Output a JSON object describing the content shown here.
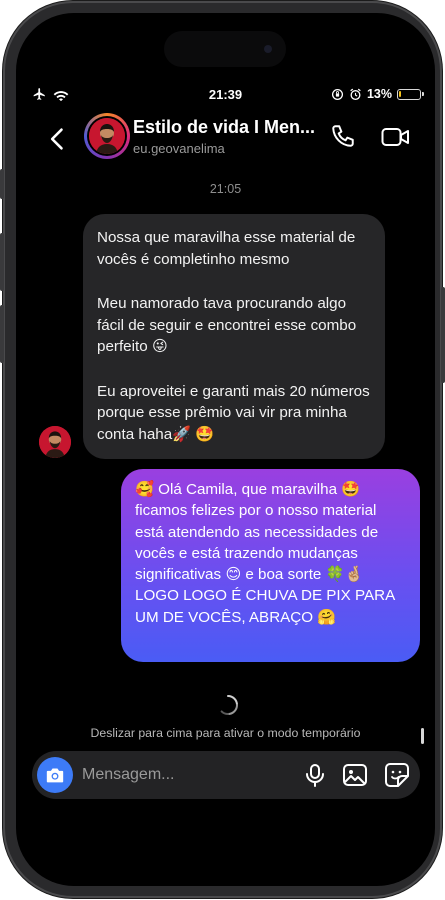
{
  "status_bar": {
    "time": "21:39",
    "battery_percent": "13%",
    "battery_level": 0.13
  },
  "header": {
    "title": "Estilo de vida I Men...",
    "username": "eu.geovanelima"
  },
  "conversation": {
    "timestamp": "21:05",
    "incoming": {
      "paragraphs": [
        "Nossa que maravilha esse material de vocês é completinho mesmo",
        "Meu namorado tava procurando algo fácil de seguir e encontrei esse combo perfeito 😜",
        "Eu aproveitei e garanti mais 20 números porque esse prêmio vai vir pra minha conta haha🚀 🤩"
      ]
    },
    "outgoing": {
      "text": "🥰 Olá Camila, que maravilha 🤩 ficamos felizes por o nosso material está atendendo as necessidades de vocês e está trazendo mudanças significativas 😊 e boa sorte 🍀🤞🏼 LOGO LOGO É CHUVA DE PIX PARA UM DE VOCÊS, ABRAÇO 🤗"
    },
    "hint": "Deslizar para cima para ativar o modo temporário"
  },
  "composer": {
    "placeholder": "Mensagem..."
  },
  "colors": {
    "background": "#000000",
    "incoming_bubble": "#262628",
    "outgoing_gradient_top": "#9a3fe0",
    "outgoing_gradient_bottom": "#4a5cf5",
    "camera_button": "#3d7bf7"
  },
  "icons": [
    "airplane-icon",
    "wifi-icon",
    "rotation-lock-icon",
    "alarm-icon",
    "battery-icon",
    "back-chevron-icon",
    "phone-call-icon",
    "video-call-icon",
    "camera-icon",
    "microphone-icon",
    "gallery-icon",
    "sticker-icon",
    "loading-spinner-icon"
  ]
}
